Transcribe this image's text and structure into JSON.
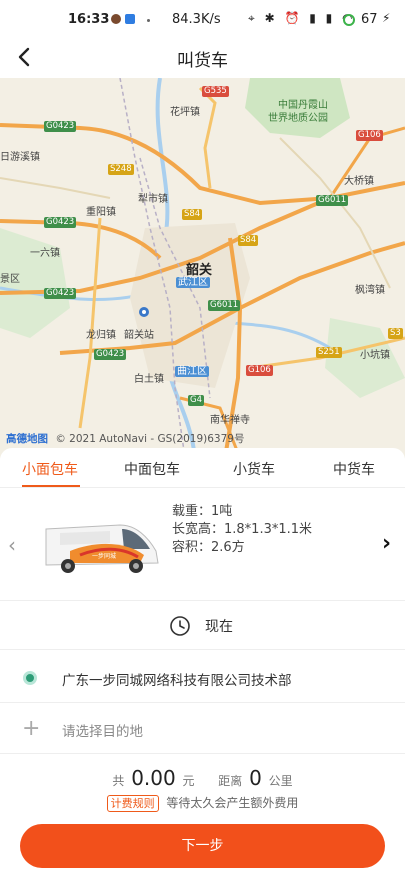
{
  "status_bar": {
    "time": "16:33",
    "network_speed": "84.3K/s",
    "system_icons": "⌖ ✱ ⏰ ▮ ▮ ◠",
    "battery": "67",
    "charging_icon": "⚡"
  },
  "header": {
    "back_icon": "chevron-left-icon",
    "title": "叫货车"
  },
  "map": {
    "city": "韶关",
    "labels": [
      "花坪镇",
      "中国丹霞山",
      "世界地质公园",
      "日游溪镇",
      "犁市镇",
      "重阳镇",
      "大桥镇",
      "一六镇",
      "景区",
      "枫湾镇",
      "武江区",
      "龙归镇",
      "韶关站",
      "白土镇",
      "曲江区",
      "小坑镇",
      "南华禅寺"
    ],
    "shields": [
      "G535",
      "G106",
      "G0423",
      "S248",
      "S84",
      "G6011",
      "G0423",
      "S84",
      "G0423",
      "G6011",
      "G0423",
      "S251",
      "G106",
      "G4",
      "S3"
    ],
    "credit_logo": "高德地图",
    "credit": "© 2021 AutoNavi - GS(2019)6379号"
  },
  "tabs": [
    "小面包车",
    "中面包车",
    "小货车",
    "中货车"
  ],
  "active_tab": 0,
  "vehicle": {
    "load": "载重：1吨",
    "dimensions": "长宽高：1.8*1.3*1.1米",
    "volume": "容积：2.6方",
    "prev_icon": "‹",
    "next_icon": "›",
    "van_brand": "一步同城"
  },
  "time_row": {
    "icon": "clock-icon",
    "label": "现在"
  },
  "from_address": "广东一步同城网络科技有限公司技术部",
  "to_address_placeholder": "请选择目的地",
  "price": {
    "prefix": "共",
    "amount": "0.00",
    "unit": "元",
    "distance_prefix": "距离",
    "distance": "0",
    "distance_unit": "公里"
  },
  "rule": {
    "button": "计费规则",
    "note": "等待太久会产生额外费用"
  },
  "next_button": "下一步",
  "colors": {
    "accent": "#f2501b",
    "map_bg": "#f3efe4",
    "road": "#f2a64a",
    "green_marker": "#2e9c77"
  }
}
